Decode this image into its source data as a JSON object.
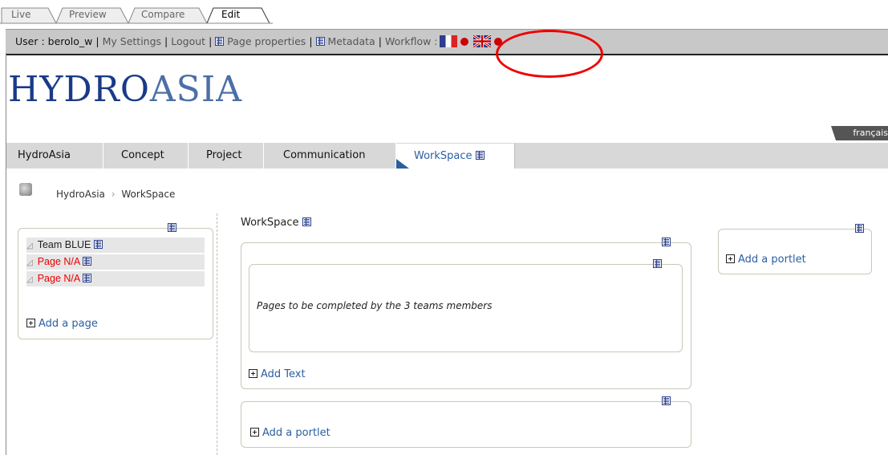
{
  "mode_tabs": [
    {
      "label": "Live"
    },
    {
      "label": "Preview"
    },
    {
      "label": "Compare"
    },
    {
      "label": "Edit",
      "active": true
    }
  ],
  "user_bar": {
    "user_text": "User : berolo_w",
    "my_settings": "My Settings",
    "logout": "Logout",
    "page_properties": "Page properties",
    "metadata": "Metadata",
    "workflow": "Workflow :"
  },
  "logo": {
    "bold": "HYDRO",
    "light": "ASIA"
  },
  "language_tab": "français",
  "main_nav": [
    {
      "label": "HydroAsia"
    },
    {
      "label": "Concept"
    },
    {
      "label": "Project"
    },
    {
      "label": "Communication"
    },
    {
      "label": "WorkSpace",
      "active": true
    }
  ],
  "breadcrumb": {
    "root": "HydroAsia",
    "separator": "›",
    "current": "WorkSpace"
  },
  "left_panel": {
    "pages": [
      {
        "label": "Team BLUE",
        "status": "normal"
      },
      {
        "label": "Page N/A",
        "status": "missing"
      },
      {
        "label": "Page N/A",
        "status": "missing"
      }
    ],
    "add_page": "Add a page"
  },
  "center": {
    "title": "WorkSpace",
    "text_content": "Pages to be completed by the 3 teams members",
    "add_text": "Add Text",
    "add_portlet": "Add a portlet"
  },
  "right_panel": {
    "add_portlet": "Add a portlet"
  },
  "colors": {
    "accent": "#2b5fa0",
    "missing": "#ee0000",
    "highlight": "#ee0000"
  }
}
